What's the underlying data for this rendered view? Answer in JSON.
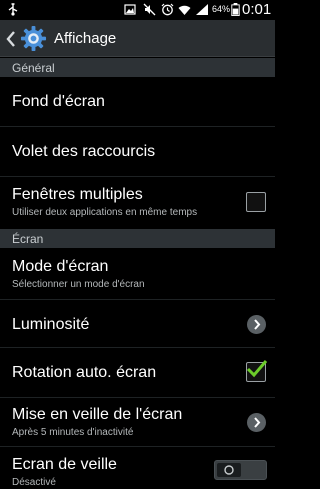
{
  "status_bar": {
    "battery_percent": "64%",
    "time": "0:01",
    "icons": [
      "usb-icon",
      "image-icon",
      "mute-icon",
      "alarm-icon",
      "wifi-icon",
      "signal-icon",
      "battery-icon"
    ]
  },
  "header": {
    "title": "Affichage"
  },
  "sections": {
    "general": "Général",
    "ecran": "Écran"
  },
  "items": {
    "fond": {
      "label": "Fond d'écran"
    },
    "volet": {
      "label": "Volet des raccourcis"
    },
    "fenetres": {
      "label": "Fenêtres multiples",
      "sub": "Utiliser deux applications en même temps",
      "checked": false
    },
    "mode": {
      "label": "Mode d'écran",
      "sub": "Sélectionner un mode d'écran"
    },
    "luminosite": {
      "label": "Luminosité"
    },
    "rotation": {
      "label": "Rotation auto. écran",
      "checked": true
    },
    "veille": {
      "label": "Mise en veille de l'écran",
      "sub": "Après 5 minutes d'inactivité"
    },
    "ecran_veille": {
      "label": "Ecran de veille",
      "sub": "Désactivé",
      "toggle": "off"
    }
  },
  "colors": {
    "accent_check": "#6ccc2a",
    "header_bg": "#2a2e31",
    "section_bg": "#2d3236"
  }
}
